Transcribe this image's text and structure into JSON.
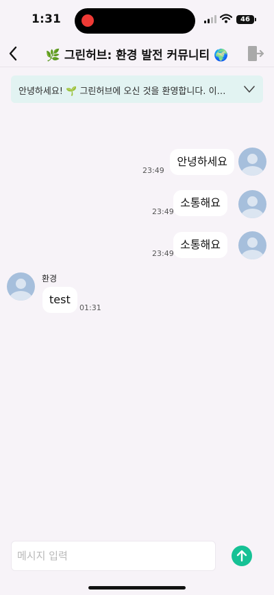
{
  "status": {
    "time": "1:31",
    "battery": "46"
  },
  "nav": {
    "title": "🌿 그린허브: 환경 발전 커뮤니티 🌍"
  },
  "notice": {
    "text": "안녕하세요! 🌱 그린허브에 오신 것을 환영합니다. 이…"
  },
  "messages": [
    {
      "text": "안녕하세요",
      "time": "23:49"
    },
    {
      "text": "소통해요",
      "time": "23:49"
    },
    {
      "text": "소통해요",
      "time": "23:49"
    },
    {
      "sender": "환경",
      "text": "test",
      "time": "01:31"
    }
  ],
  "composer": {
    "placeholder": "메시지 입력"
  },
  "colors": {
    "accent": "#16c195",
    "notice_bg": "#e2f3f2",
    "avatar": "#a6bfdc",
    "recording": "#ef3a35"
  }
}
